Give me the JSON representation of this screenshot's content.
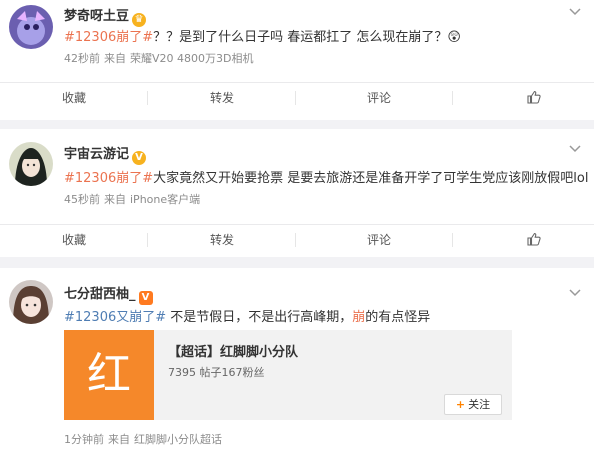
{
  "posts": [
    {
      "username": "梦奇呀土豆",
      "badge": "crown",
      "text_parts": [
        {
          "t": "#12306崩了#",
          "k": "tag"
        },
        {
          "t": "？？是到了什么日子吗 春运都扛了 怎么现在崩了？",
          "k": "plain"
        },
        {
          "t": "😲",
          "k": "plain"
        }
      ],
      "time": "42秒前",
      "source_prefix": "来自",
      "source": "荣耀V20 4800万3D相机"
    },
    {
      "username": "宇宙云游记",
      "badge": "V",
      "text_parts": [
        {
          "t": "#12306崩了#",
          "k": "tag"
        },
        {
          "t": "大家竟然又开始要抢票 是要去旅游还是准备开学了可学生党应该刚放假吧lol",
          "k": "plain"
        }
      ],
      "time": "45秒前",
      "source_prefix": "来自",
      "source": "iPhone客户端"
    },
    {
      "username": "七分甜西柚_",
      "badge": "V",
      "text_parts": [
        {
          "t": "#12306又崩了#",
          "k": "link"
        },
        {
          "t": " 不是节假日，不是出行高峰期，",
          "k": "plain"
        },
        {
          "t": "崩",
          "k": "tag"
        },
        {
          "t": "的有点怪异",
          "k": "plain"
        }
      ],
      "time": "1分钟前",
      "source_prefix": "来自",
      "source": "红脚脚小分队超话",
      "super_topic": {
        "logo_char": "红",
        "title": "【超话】红脚脚小分队",
        "stats": "7395 帖子167粉丝",
        "follow_label": "关注",
        "follow_plus": "+"
      }
    }
  ],
  "actions": {
    "favorite": "收藏",
    "repost": "转发",
    "comment": "评论",
    "like_icon": "thumbs-up-icon"
  },
  "colors": {
    "tag": "#eb7350",
    "link": "#4f7db3",
    "accent": "#ff8200"
  }
}
